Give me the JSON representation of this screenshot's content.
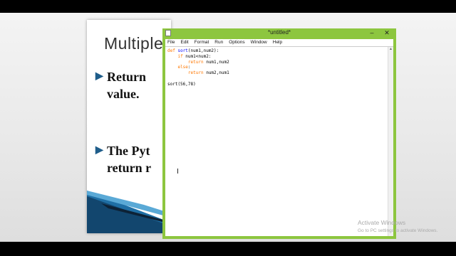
{
  "slide": {
    "title": "Multiple",
    "bullets": [
      {
        "line1": "Return",
        "line2": "value."
      },
      {
        "line1": "The Pyt",
        "line2": "return r"
      }
    ]
  },
  "idle_window": {
    "title": "*untitled*",
    "menu": [
      "File",
      "Edit",
      "Format",
      "Run",
      "Options",
      "Window",
      "Help"
    ],
    "code_lines": [
      {
        "kw": "def",
        "fn": "sort",
        "rest": "(num1,num2):",
        "indent": ""
      },
      {
        "kw": "if",
        "fn": "",
        "rest": " num1<num2:",
        "indent": "    "
      },
      {
        "kw": "return",
        "fn": "",
        "rest": " num1,num2",
        "indent": "        "
      },
      {
        "kw": "else",
        "fn": "",
        "rest": ":",
        "indent": "    "
      },
      {
        "kw": "return",
        "fn": "",
        "rest": " num2,num1",
        "indent": "        "
      },
      {
        "kw": "",
        "fn": "",
        "rest": "",
        "indent": ""
      },
      {
        "kw": "",
        "fn": "",
        "rest": "sort(56,78)",
        "indent": ""
      }
    ]
  },
  "watermark": {
    "line1": "Activate Windows",
    "line2": "Go to PC settings to activate Windows."
  },
  "colors": {
    "idle_frame": "#8dc63f",
    "slide_accent": "#1f5d8a",
    "keyword": "#ff7700",
    "function_name": "#0000ff"
  },
  "icons": {
    "app": "idle-app-icon",
    "minimize": "minimize-icon",
    "close": "close-icon",
    "bullet": "arrow-bullet-icon",
    "cursor": "text-cursor-icon"
  }
}
